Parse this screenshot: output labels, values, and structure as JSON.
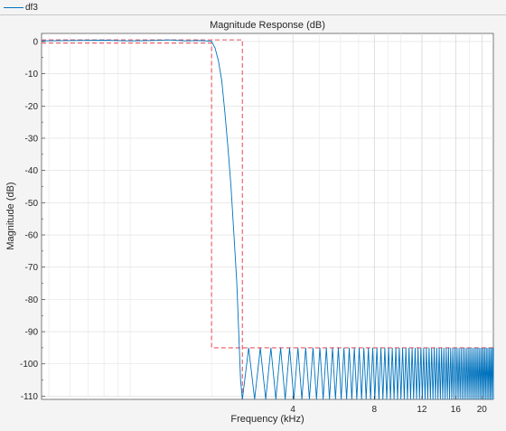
{
  "legend": {
    "entry": "df3"
  },
  "chart_data": {
    "type": "line",
    "title": "Magnitude Response (dB)",
    "xlabel": "Frequency (kHz)",
    "ylabel": "Magnitude (dB)",
    "xscale": "log",
    "xlim": [
      0.47,
      22.05
    ],
    "ylim": [
      -111,
      2.5
    ],
    "x_ticks": [
      4,
      8,
      12,
      16,
      20
    ],
    "x_tick_labels": [
      "4",
      "8",
      "12",
      "16",
      "20"
    ],
    "y_ticks": [
      0,
      -10,
      -20,
      -30,
      -40,
      -50,
      -60,
      -70,
      -80,
      -90,
      -100,
      -110
    ],
    "y_tick_labels": [
      "0",
      "-10",
      "-20",
      "-30",
      "-40",
      "-50",
      "-60",
      "-70",
      "-80",
      "-90",
      "-100",
      "-110"
    ],
    "grid": true,
    "series": [
      {
        "name": "df3",
        "color": "#0072bd",
        "passband": {
          "x": [
            0.47,
            0.6,
            0.8,
            1.0,
            1.2,
            1.4,
            1.6,
            1.8,
            2.0
          ],
          "y": [
            0.2,
            0.3,
            0.4,
            0.2,
            0.3,
            0.5,
            0.2,
            0.3,
            0.1
          ]
        },
        "transition": {
          "x": [
            2.0,
            2.06,
            2.12,
            2.18,
            2.24,
            2.3,
            2.36,
            2.42,
            2.48,
            2.52,
            2.56,
            2.6
          ],
          "y": [
            0,
            -2,
            -6,
            -12,
            -22,
            -33,
            -45,
            -60,
            -75,
            -90,
            -105,
            -111
          ]
        },
        "stopband": {
          "start": 2.6,
          "end": 22.05,
          "ripple_top": -95,
          "ripple_bottom": -111,
          "lobes_per_kHz": 3.5
        }
      }
    ],
    "constraint_mask": {
      "color": "#e8565f",
      "passband_edge": 2.0,
      "stopband_edge": 2.6,
      "passband_ripple": [
        0.5,
        -0.5
      ],
      "stopband_attenuation": -95
    }
  }
}
